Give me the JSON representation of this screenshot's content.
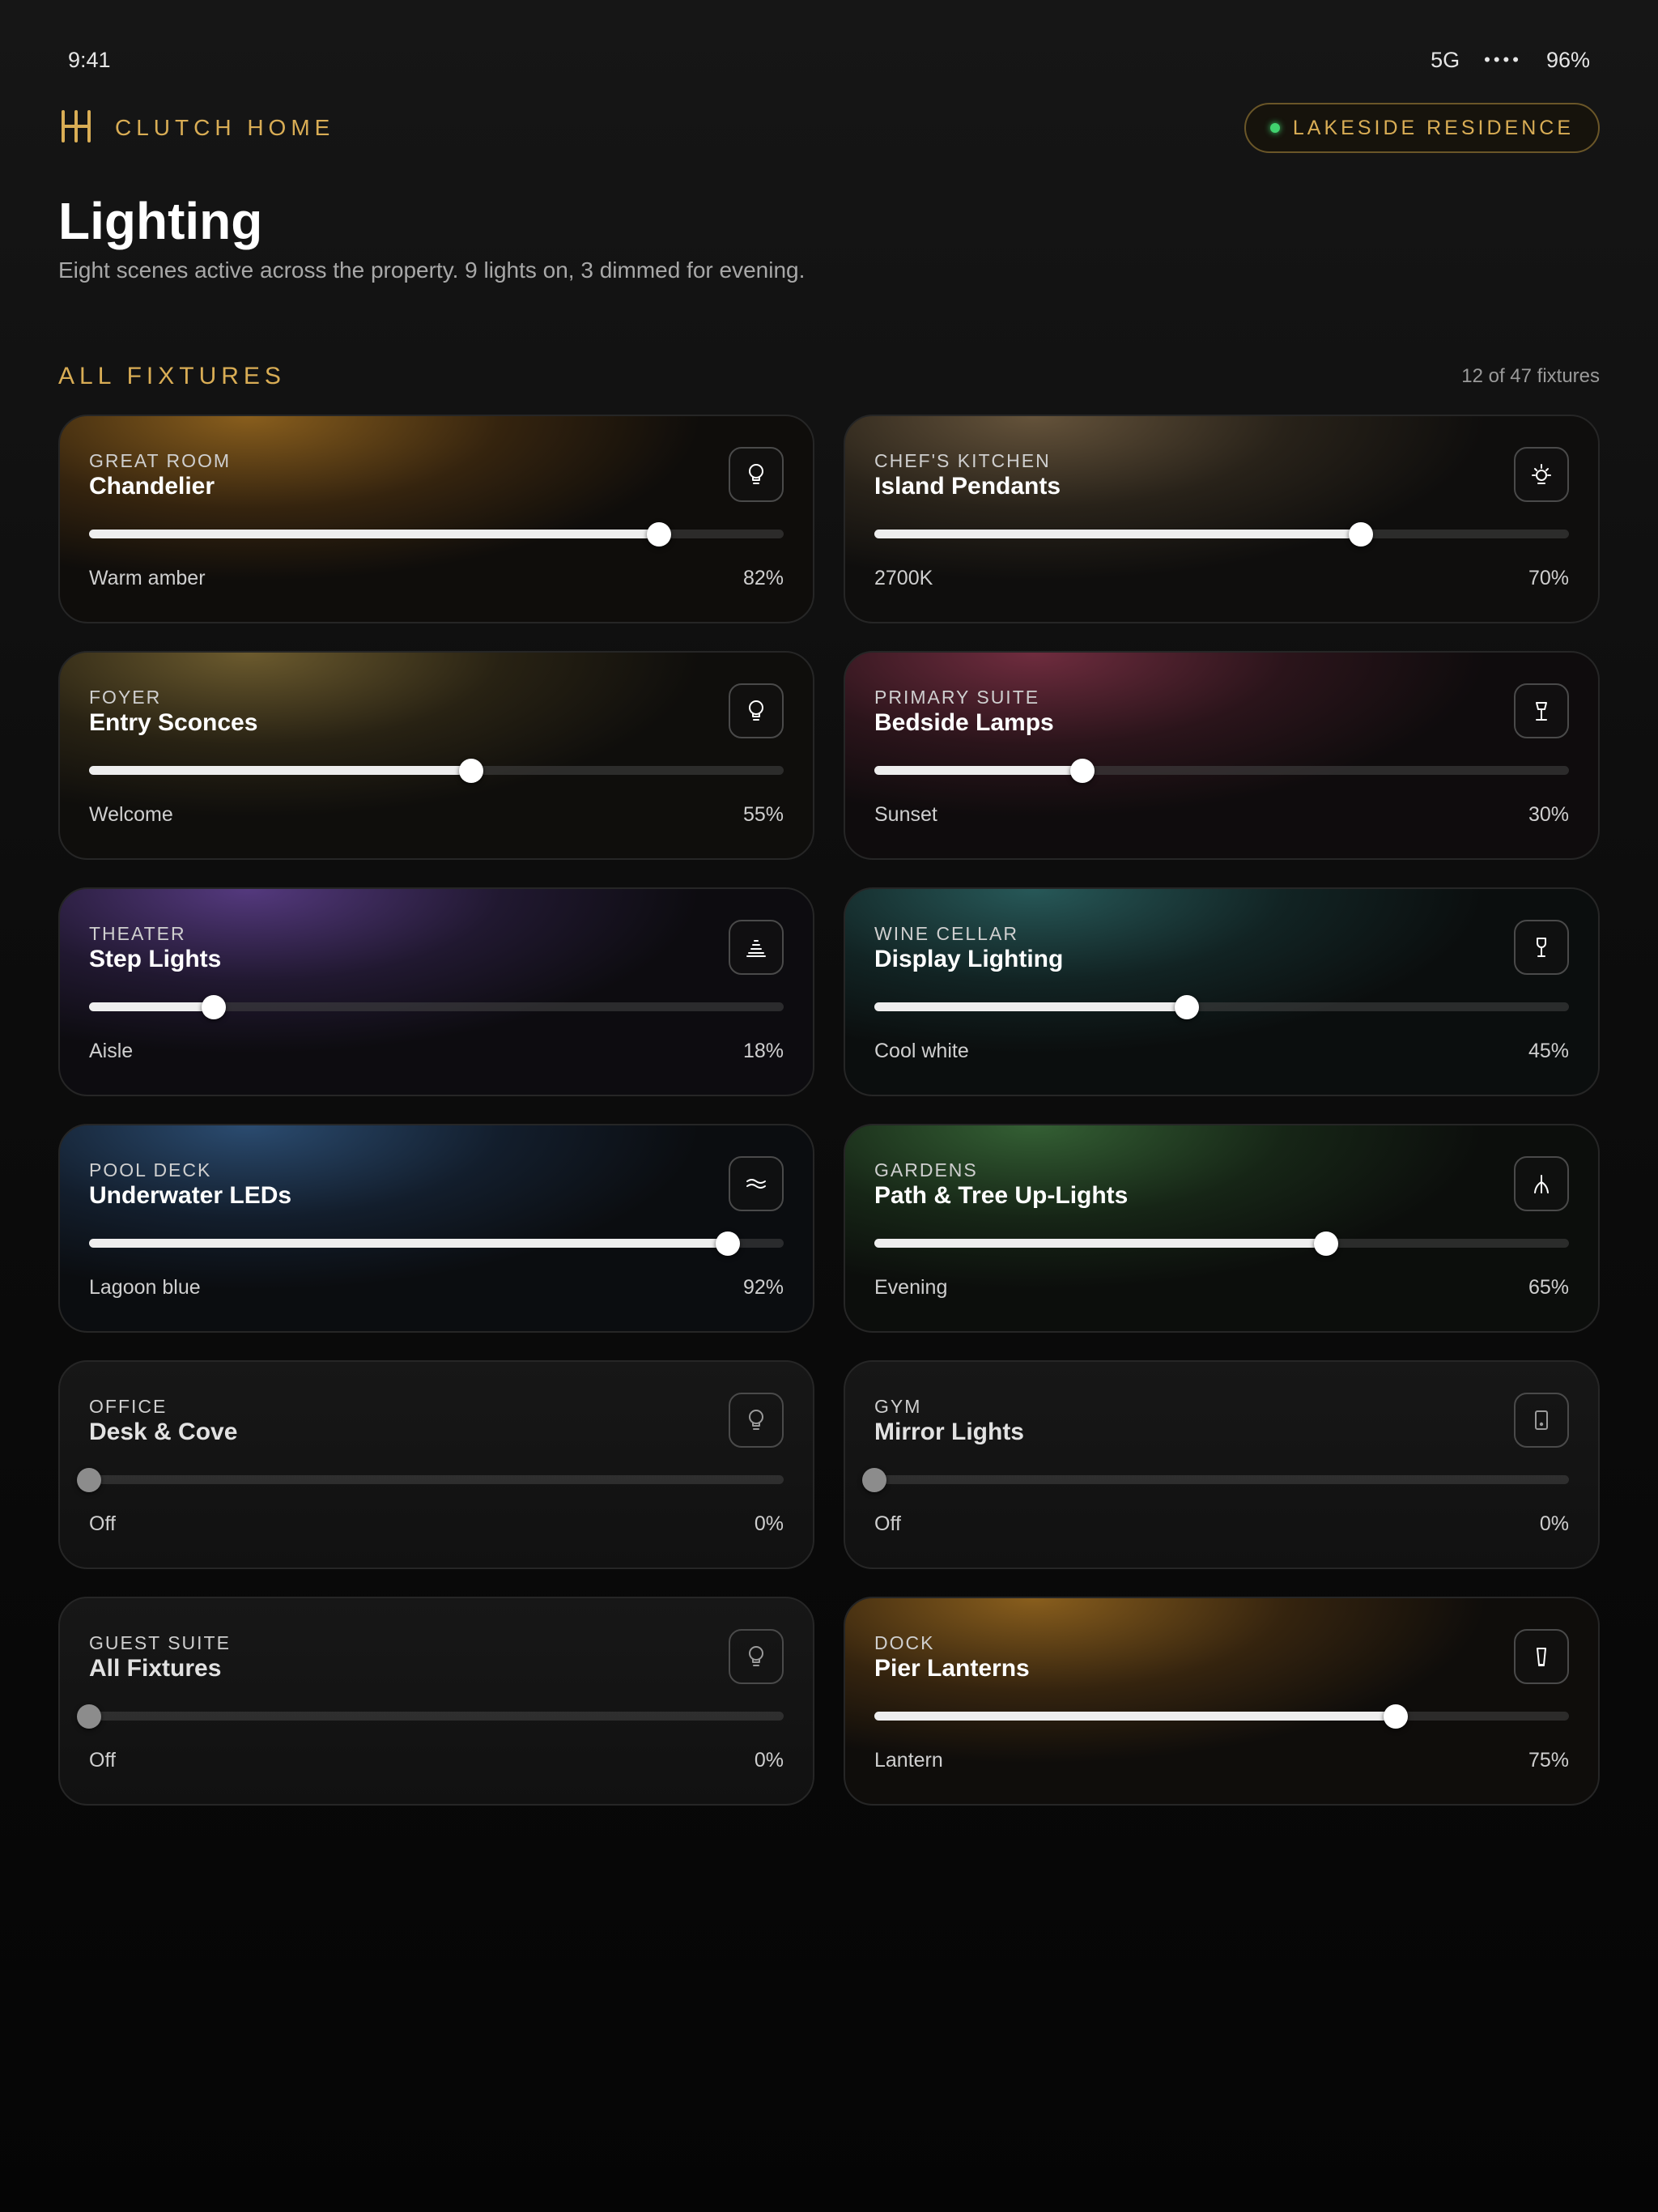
{
  "status_bar": {
    "time": "9:41",
    "network": "5G",
    "signal": "••••",
    "battery": "96%"
  },
  "header": {
    "brand": "CLUTCH HOME",
    "logo_icon": "clutch-logo",
    "location": "LAKESIDE RESIDENCE",
    "accent_color": "#d9ad55",
    "status_dot_color": "#41d36f"
  },
  "page": {
    "title": "Lighting",
    "subtitle": "Eight scenes active across the property. 9 lights on, 3 dimmed for evening."
  },
  "section": {
    "label": "ALL FIXTURES",
    "count": "12 of 47 fixtures"
  },
  "fixtures": [
    {
      "room": "GREAT ROOM",
      "name": "Chandelier",
      "scene": "Warm amber",
      "percent_label": "82%",
      "level": 82,
      "theme": "amber",
      "icon": "bulb-icon"
    },
    {
      "room": "CHEF'S KITCHEN",
      "name": "Island Pendants",
      "scene": "2700K",
      "percent_label": "70%",
      "level": 70,
      "theme": "tan",
      "icon": "sun-icon"
    },
    {
      "room": "FOYER",
      "name": "Entry Sconces",
      "scene": "Welcome",
      "percent_label": "55%",
      "level": 55,
      "theme": "olive",
      "icon": "bulb-icon"
    },
    {
      "room": "PRIMARY SUITE",
      "name": "Bedside Lamps",
      "scene": "Sunset",
      "percent_label": "30%",
      "level": 30,
      "theme": "rose",
      "icon": "lamp-icon"
    },
    {
      "room": "THEATER",
      "name": "Step Lights",
      "scene": "Aisle",
      "percent_label": "18%",
      "level": 18,
      "theme": "violet",
      "icon": "steps-icon"
    },
    {
      "room": "WINE CELLAR",
      "name": "Display Lighting",
      "scene": "Cool white",
      "percent_label": "45%",
      "level": 45,
      "theme": "teal",
      "icon": "wine-glass-icon"
    },
    {
      "room": "POOL DECK",
      "name": "Underwater LEDs",
      "scene": "Lagoon blue",
      "percent_label": "92%",
      "level": 92,
      "theme": "blue",
      "icon": "waves-icon"
    },
    {
      "room": "GARDENS",
      "name": "Path & Tree Up-Lights",
      "scene": "Evening",
      "percent_label": "65%",
      "level": 65,
      "theme": "green",
      "icon": "tree-icon"
    },
    {
      "room": "OFFICE",
      "name": "Desk & Cove",
      "scene": "Off",
      "percent_label": "0%",
      "level": 0,
      "theme": "none",
      "icon": "bulb-icon"
    },
    {
      "room": "GYM",
      "name": "Mirror Lights",
      "scene": "Off",
      "percent_label": "0%",
      "level": 0,
      "theme": "none",
      "icon": "mirror-icon"
    },
    {
      "room": "GUEST SUITE",
      "name": "All Fixtures",
      "scene": "Off",
      "percent_label": "0%",
      "level": 0,
      "theme": "none",
      "icon": "bulb-icon"
    },
    {
      "room": "DOCK",
      "name": "Pier Lanterns",
      "scene": "Lantern",
      "percent_label": "75%",
      "level": 75,
      "theme": "amber",
      "icon": "lantern-icon"
    }
  ]
}
